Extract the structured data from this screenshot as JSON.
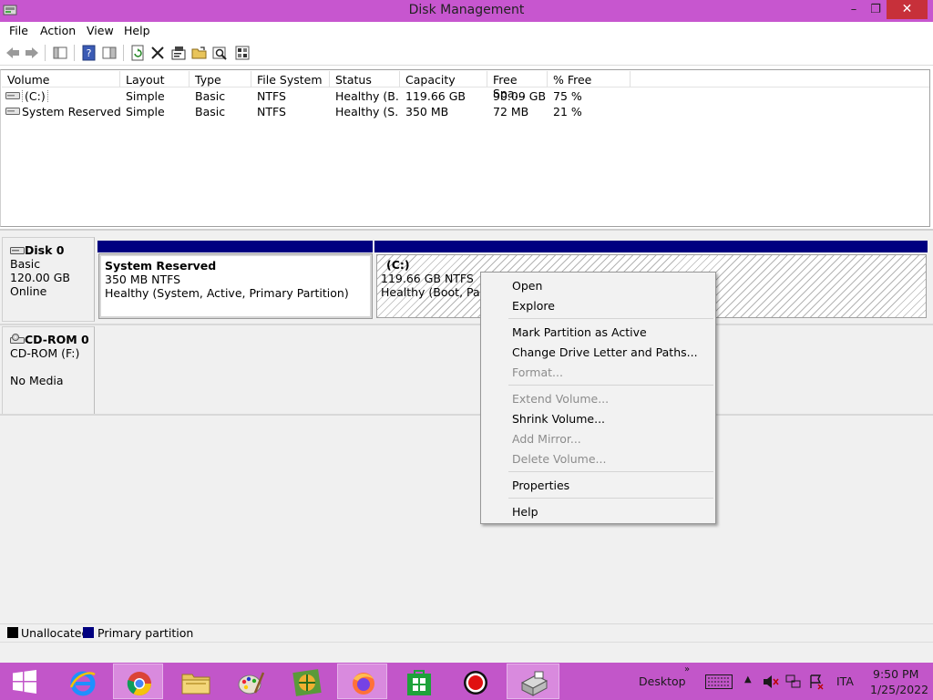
{
  "window": {
    "title": "Disk Management",
    "controls": {
      "minimize": "–",
      "restore": "❐",
      "close": "✕"
    }
  },
  "menu": [
    "File",
    "Action",
    "View",
    "Help"
  ],
  "toolbar": {
    "icons": [
      "back-arrow-icon",
      "forward-arrow-icon",
      "console-tree-icon",
      "help-icon",
      "show-hide-icon",
      "refresh-icon",
      "delete-icon",
      "properties-icon",
      "open-icon",
      "find-icon",
      "settings-icon"
    ]
  },
  "volume_list": {
    "columns": [
      "Volume",
      "Layout",
      "Type",
      "File System",
      "Status",
      "Capacity",
      "Free Spa...",
      "% Free"
    ],
    "rows": [
      {
        "volume": "(C:)",
        "layout": "Simple",
        "type": "Basic",
        "fs": "NTFS",
        "status": "Healthy (B...",
        "capacity": "119.66 GB",
        "free": "90.09 GB",
        "pct": "75 %"
      },
      {
        "volume": "System Reserved",
        "layout": "Simple",
        "type": "Basic",
        "fs": "NTFS",
        "status": "Healthy (S...",
        "capacity": "350 MB",
        "free": "72 MB",
        "pct": "21 %"
      }
    ]
  },
  "disks": {
    "disk0": {
      "name": "Disk 0",
      "type": "Basic",
      "size": "120.00 GB",
      "state": "Online",
      "partitions": [
        {
          "name": "System Reserved",
          "size": "350 MB NTFS",
          "status": "Healthy (System, Active, Primary Partition)"
        },
        {
          "name": "(C:)",
          "size": "119.66 GB NTFS",
          "status": "Healthy (Boot, Page"
        }
      ]
    },
    "cdrom0": {
      "name": "CD-ROM 0",
      "drive": "CD-ROM (F:)",
      "media": "No Media"
    }
  },
  "legend": [
    {
      "label": "Unallocated",
      "color": "#000000"
    },
    {
      "label": "Primary partition",
      "color": "#000080"
    }
  ],
  "context_menu": {
    "items": [
      {
        "label": "Open",
        "enabled": true
      },
      {
        "label": "Explore",
        "enabled": true
      },
      {
        "label": "Mark Partition as Active",
        "enabled": true
      },
      {
        "label": "Change Drive Letter and Paths...",
        "enabled": true
      },
      {
        "label": "Format...",
        "enabled": false
      },
      {
        "label": "Extend Volume...",
        "enabled": false
      },
      {
        "label": "Shrink Volume...",
        "enabled": true
      },
      {
        "label": "Add Mirror...",
        "enabled": false
      },
      {
        "label": "Delete Volume...",
        "enabled": false
      },
      {
        "label": "Properties",
        "enabled": true
      },
      {
        "label": "Help",
        "enabled": true
      }
    ]
  },
  "taskbar": {
    "apps": [
      "start-icon",
      "internet-explorer-icon",
      "chrome-icon",
      "file-explorer-icon",
      "paint-icon",
      "maps-icon",
      "firefox-icon",
      "store-icon",
      "recorder-icon",
      "disk-management-icon"
    ],
    "desktop_label": "Desktop",
    "language": "ITA",
    "time": "9:50 PM",
    "date": "1/25/2022"
  },
  "colors": {
    "title_bar": "#c756cf",
    "taskbar": "#c256c9",
    "primary_partition": "#000080",
    "close_button": "#c7303a"
  }
}
